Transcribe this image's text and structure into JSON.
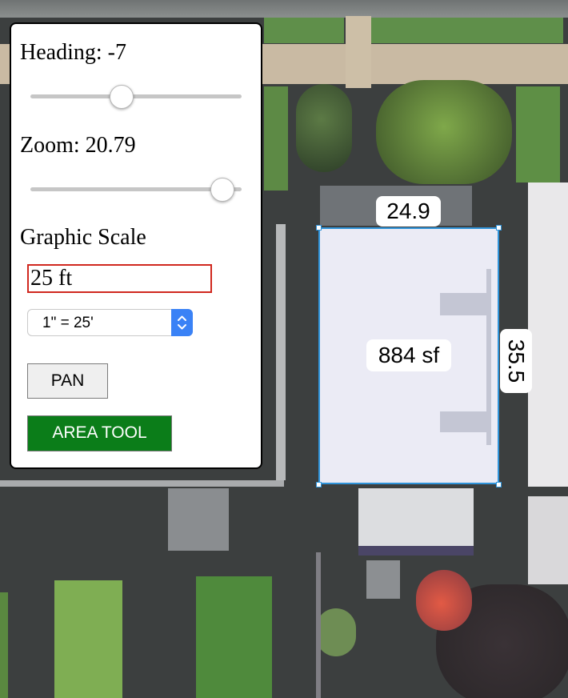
{
  "controls": {
    "heading_label": "Heading: -7",
    "heading_value": -7,
    "heading_slider_level": 0.43,
    "zoom_label": "Zoom: 20.79",
    "zoom_value": 20.79,
    "zoom_slider_level": 0.91,
    "graphic_scale_label": "Graphic Scale",
    "scale_input_value": "25 ft",
    "scale_select_value": "1\" = 25'",
    "pan_button": "PAN",
    "area_tool_button": "AREA TOOL"
  },
  "measurement": {
    "width_label": "24.9",
    "height_label": "35.5",
    "area_label": "884 sf"
  },
  "colors": {
    "area_tool_green": "#0b7d19",
    "polygon_stroke": "#2f93d9",
    "scale_input_border": "#d0281f",
    "select_accent": "#3a82f6"
  },
  "icons": {
    "select_arrows": "chevron-up-down-icon"
  }
}
